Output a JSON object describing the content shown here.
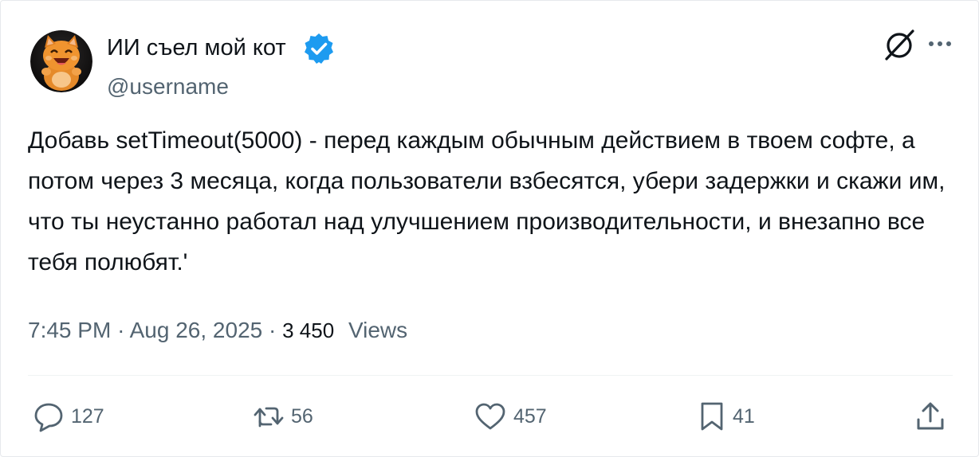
{
  "author": {
    "display_name": "ИИ съел мой кот",
    "handle": "@username",
    "verified": true,
    "avatar_icon": "orange-cat-avatar"
  },
  "tweet": {
    "text": "Добавь setTimeout(5000) - перед каждым обычным действием в твоем софте, а потом через 3 месяца, когда пользователи взбесятся, убери задержки и скажи им, что ты неустанно работал над улучшением производительности, и внезапно все тебя полюбят.'"
  },
  "meta": {
    "time": "7:45 PM",
    "separator": "·",
    "date": "Aug 26, 2025",
    "views_count": "3 450",
    "views_label": "Views"
  },
  "actions": {
    "reply_count": "127",
    "repost_count": "56",
    "like_count": "457",
    "bookmark_count": "41"
  },
  "colors": {
    "text_primary": "#0f1419",
    "text_secondary": "#536471",
    "verified_blue": "#1d9bf0",
    "divider": "#eff3f4"
  },
  "icons": [
    "grok-icon",
    "more-icon",
    "verified-badge-icon",
    "reply-icon",
    "repost-icon",
    "like-icon",
    "bookmark-icon",
    "share-icon"
  ]
}
